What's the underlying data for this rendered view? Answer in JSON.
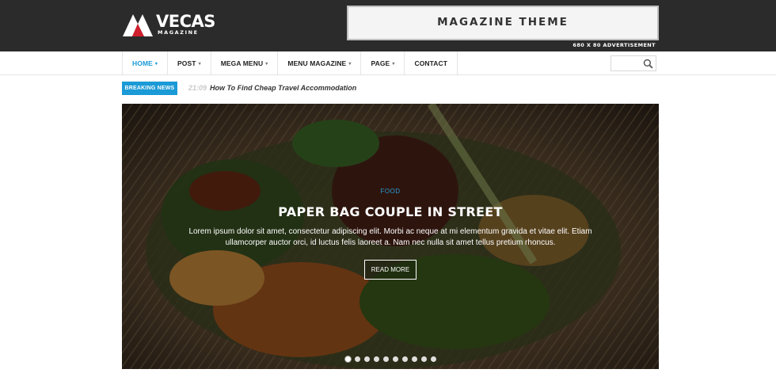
{
  "header": {
    "logo_title": "VECAS",
    "logo_sub": "MAGAZINE",
    "ad_title": "MAGAZINE THEME",
    "ad_sub": "680 X 80 ADVERTISEMENT"
  },
  "nav": {
    "items": [
      {
        "label": "HOME",
        "has_caret": true,
        "active": true
      },
      {
        "label": "POST",
        "has_caret": true
      },
      {
        "label": "MEGA MENU",
        "has_caret": true
      },
      {
        "label": "MENU MAGAZINE",
        "has_caret": true
      },
      {
        "label": "PAGE",
        "has_caret": true
      },
      {
        "label": "CONTACT",
        "has_caret": false
      }
    ],
    "caret": "▾",
    "search_placeholder": ""
  },
  "breaking": {
    "label": "BREAKING NEWS",
    "time": "21:09",
    "headline": "How To Find Cheap Travel Accommodation"
  },
  "hero": {
    "category": "FOOD",
    "title": "PAPER BAG COUPLE IN STREET",
    "excerpt": "Lorem ipsum dolor sit amet, consectetur adipiscing elit. Morbi ac neque at mi elementum gravida et vitae elit. Etiam ullamcorper auctor orci, id luctus felis laoreet a. Nam nec nulla sit amet tellus pretium rhoncus.",
    "button": "READ MORE",
    "slide_count": 10,
    "active_slide": 0
  },
  "colors": {
    "accent": "#1a9ad6",
    "topbar": "#2b2b2b",
    "logo_red": "#d0202e"
  }
}
